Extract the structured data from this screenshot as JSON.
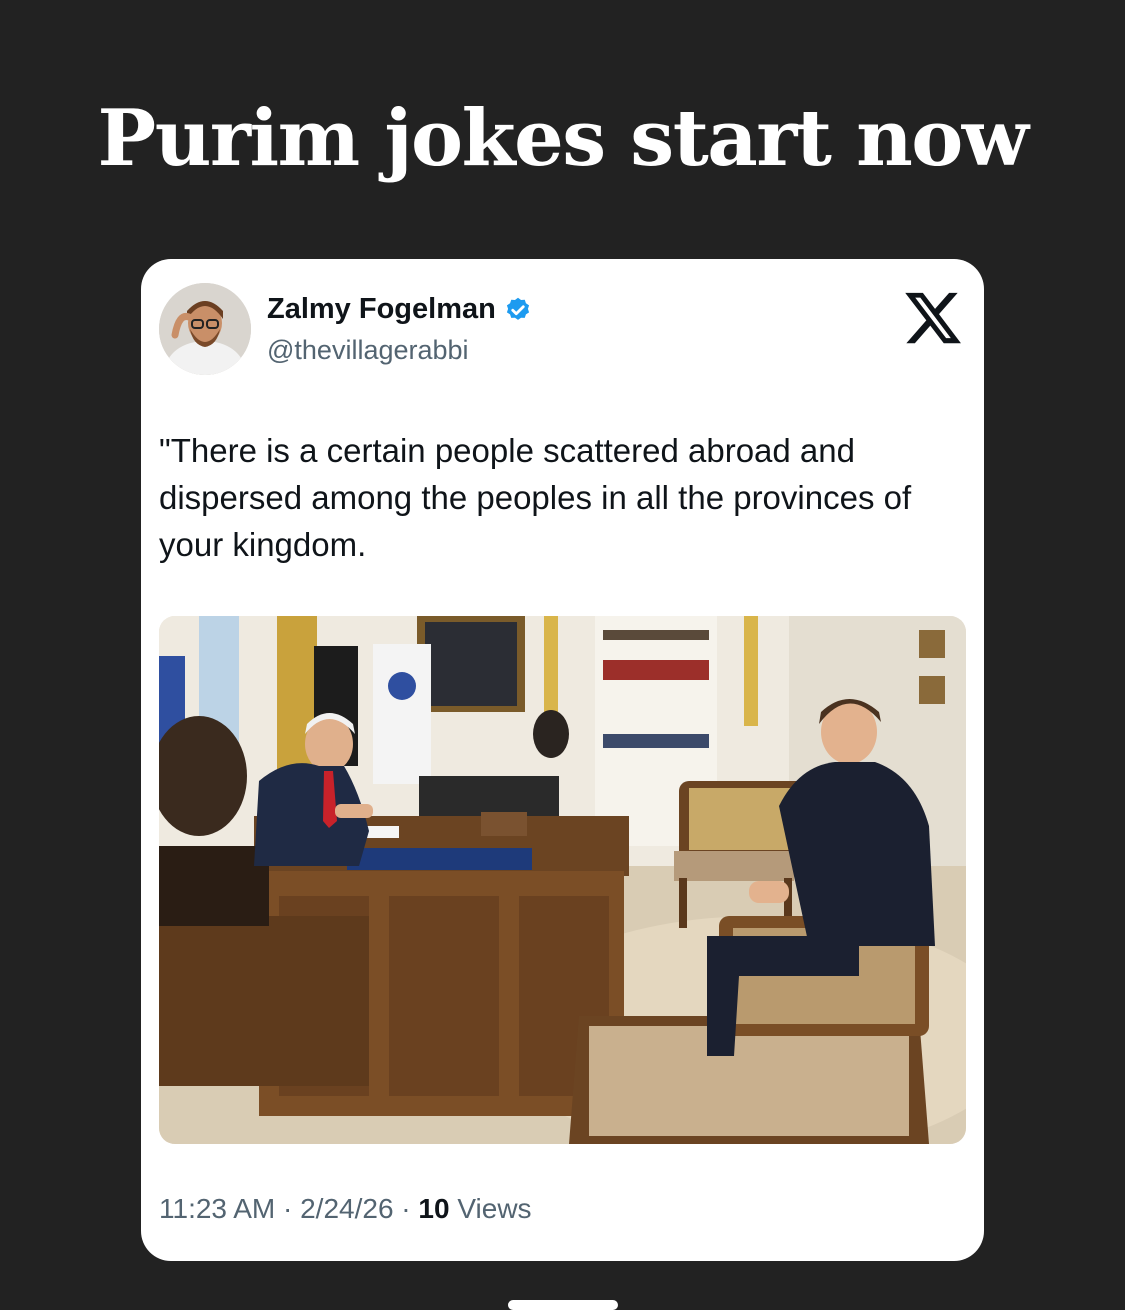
{
  "headline": "Purim jokes start now",
  "post": {
    "author": {
      "display_name": "Zalmy Fogelman",
      "handle": "@thevillagerabbi",
      "verified_icon": "verified-badge-icon",
      "verified_color": "#1d9bf0"
    },
    "platform_icon": "x-logo-icon",
    "text": "\"There is a certain people scattered abroad and dispersed among the peoples in all the provinces of your kingdom.",
    "timestamp": "11:23 AM · 2/24/26 · ",
    "views_count": "10",
    "views_label": " Views"
  },
  "colors": {
    "background": "#222222",
    "card": "#ffffff",
    "text_primary": "#0f1419",
    "text_secondary": "#536471"
  }
}
